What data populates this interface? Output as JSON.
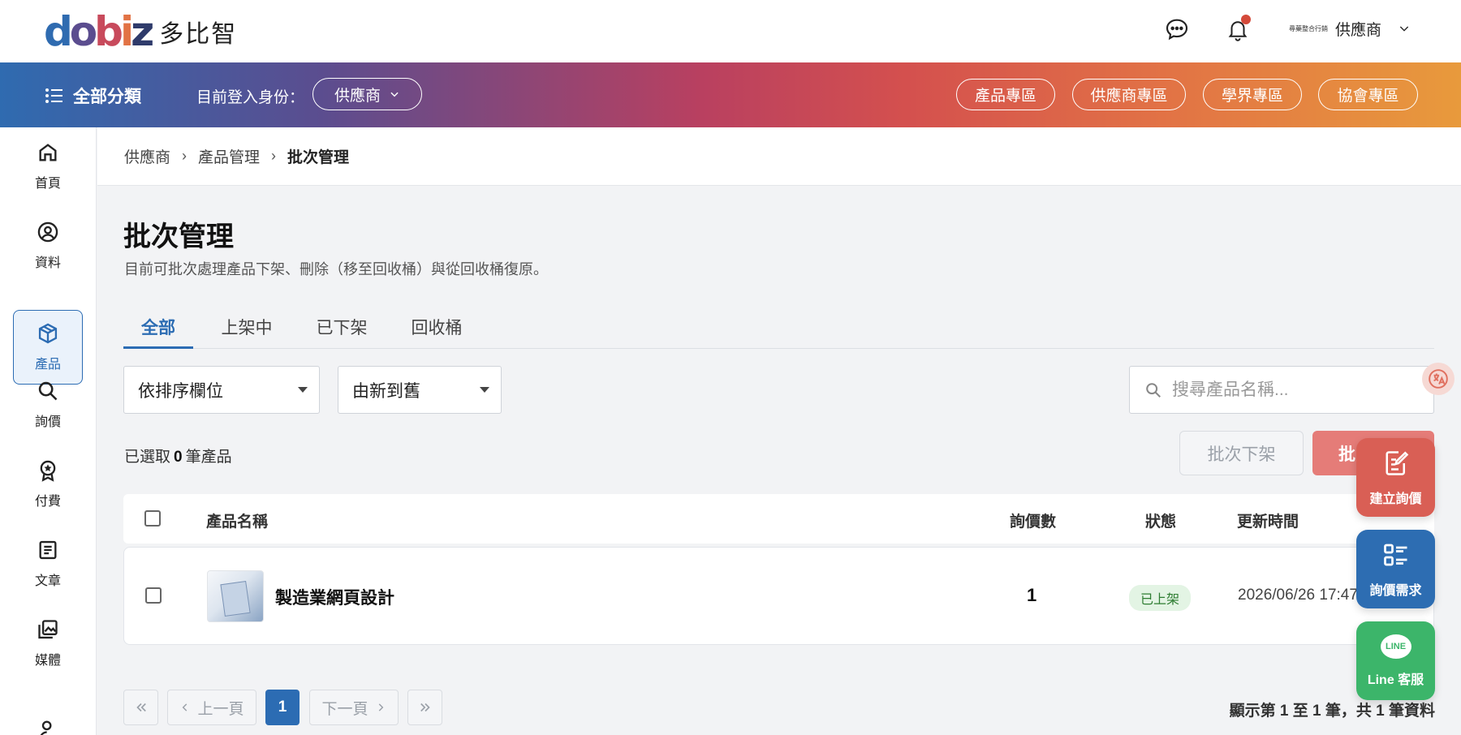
{
  "header": {
    "logo_mark": "dobiz",
    "logo_text": "多比智",
    "user_role": "供應商",
    "user_avatar_text": "尋藥整合行銷"
  },
  "navbar": {
    "all_categories": "全部分類",
    "identity_label": "目前登入身份：",
    "identity_value": "供應商",
    "zones": [
      "產品專區",
      "供應商專區",
      "學界專區",
      "協會專區"
    ]
  },
  "sidebar": {
    "items": [
      {
        "label": "首頁",
        "icon": "home-icon"
      },
      {
        "label": "資料",
        "icon": "user-circle-icon"
      },
      {
        "label": "產品",
        "icon": "package-icon"
      },
      {
        "label": "詢價",
        "icon": "search-icon"
      },
      {
        "label": "付費",
        "icon": "badge-icon"
      },
      {
        "label": "文章",
        "icon": "document-icon"
      },
      {
        "label": "媒體",
        "icon": "media-icon"
      }
    ],
    "active_index": 2
  },
  "breadcrumb": [
    "供應商",
    "產品管理",
    "批次管理"
  ],
  "page": {
    "title": "批次管理",
    "description": "目前可批次處理產品下架、刪除（移至回收桶）與從回收桶復原。"
  },
  "tabs": [
    "全部",
    "上架中",
    "已下架",
    "回收桶"
  ],
  "filters": {
    "sort_field": "依排序欄位",
    "sort_order": "由新到舊"
  },
  "search": {
    "placeholder": "搜尋產品名稱..."
  },
  "selection": {
    "prefix": "已選取",
    "count": "0",
    "suffix": "筆產品"
  },
  "actions": {
    "batch_unpublish": "批次下架",
    "batch_delete": "批"
  },
  "table": {
    "headers": {
      "name": "產品名稱",
      "inquiries": "詢價數",
      "status": "狀態",
      "updated": "更新時間"
    },
    "rows": [
      {
        "name": "製造業網頁設計",
        "inquiries": "1",
        "status": "已上架",
        "updated": "2026/06/26 17:47"
      }
    ]
  },
  "pagination": {
    "prev": "上一頁",
    "next": "下一頁",
    "current": "1",
    "summary": "顯示第 1 至 1 筆，共 1 筆資料"
  },
  "fabs": {
    "create_inquiry": "建立詢價",
    "inquiry_demand": "詢價需求",
    "line_service": "Line 客服",
    "line_logo": "LINE"
  },
  "colors": {
    "primary": "#2c6cb3",
    "danger": "#e57c78",
    "fab_red": "#d95f55",
    "fab_blue": "#2d6db2",
    "fab_green": "#3cb56a"
  }
}
